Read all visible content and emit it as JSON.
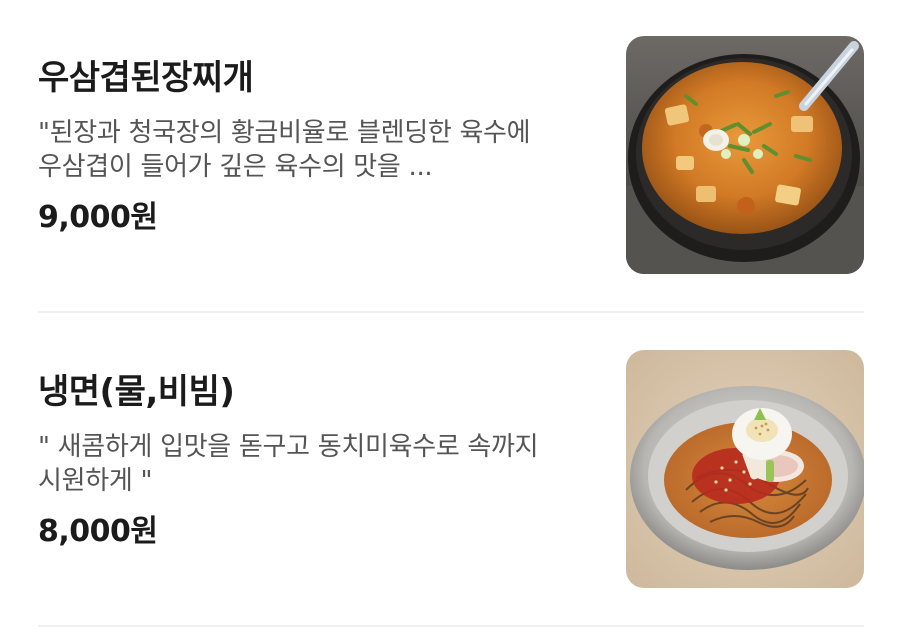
{
  "menu": {
    "items": [
      {
        "name": "우삼겹된장찌개",
        "description": "\"된장과 청국장의 황금비율로 블렌딩한 육수에 우삼겹이 들어가 깊은 육수의 맛을 ...",
        "price": "9,000원",
        "image_icon": "doenjang-jjigae-photo"
      },
      {
        "name": "냉면(물,비빔)",
        "description": "\" 새콤하게 입맛을 돋구고 동치미육수로 속까지 시원하게 \"",
        "price": "8,000원",
        "image_icon": "naengmyeon-photo"
      }
    ]
  },
  "colors": {
    "title": "#1b1b1b",
    "description": "#555555",
    "divider": "#f0f0f0",
    "background": "#ffffff"
  }
}
